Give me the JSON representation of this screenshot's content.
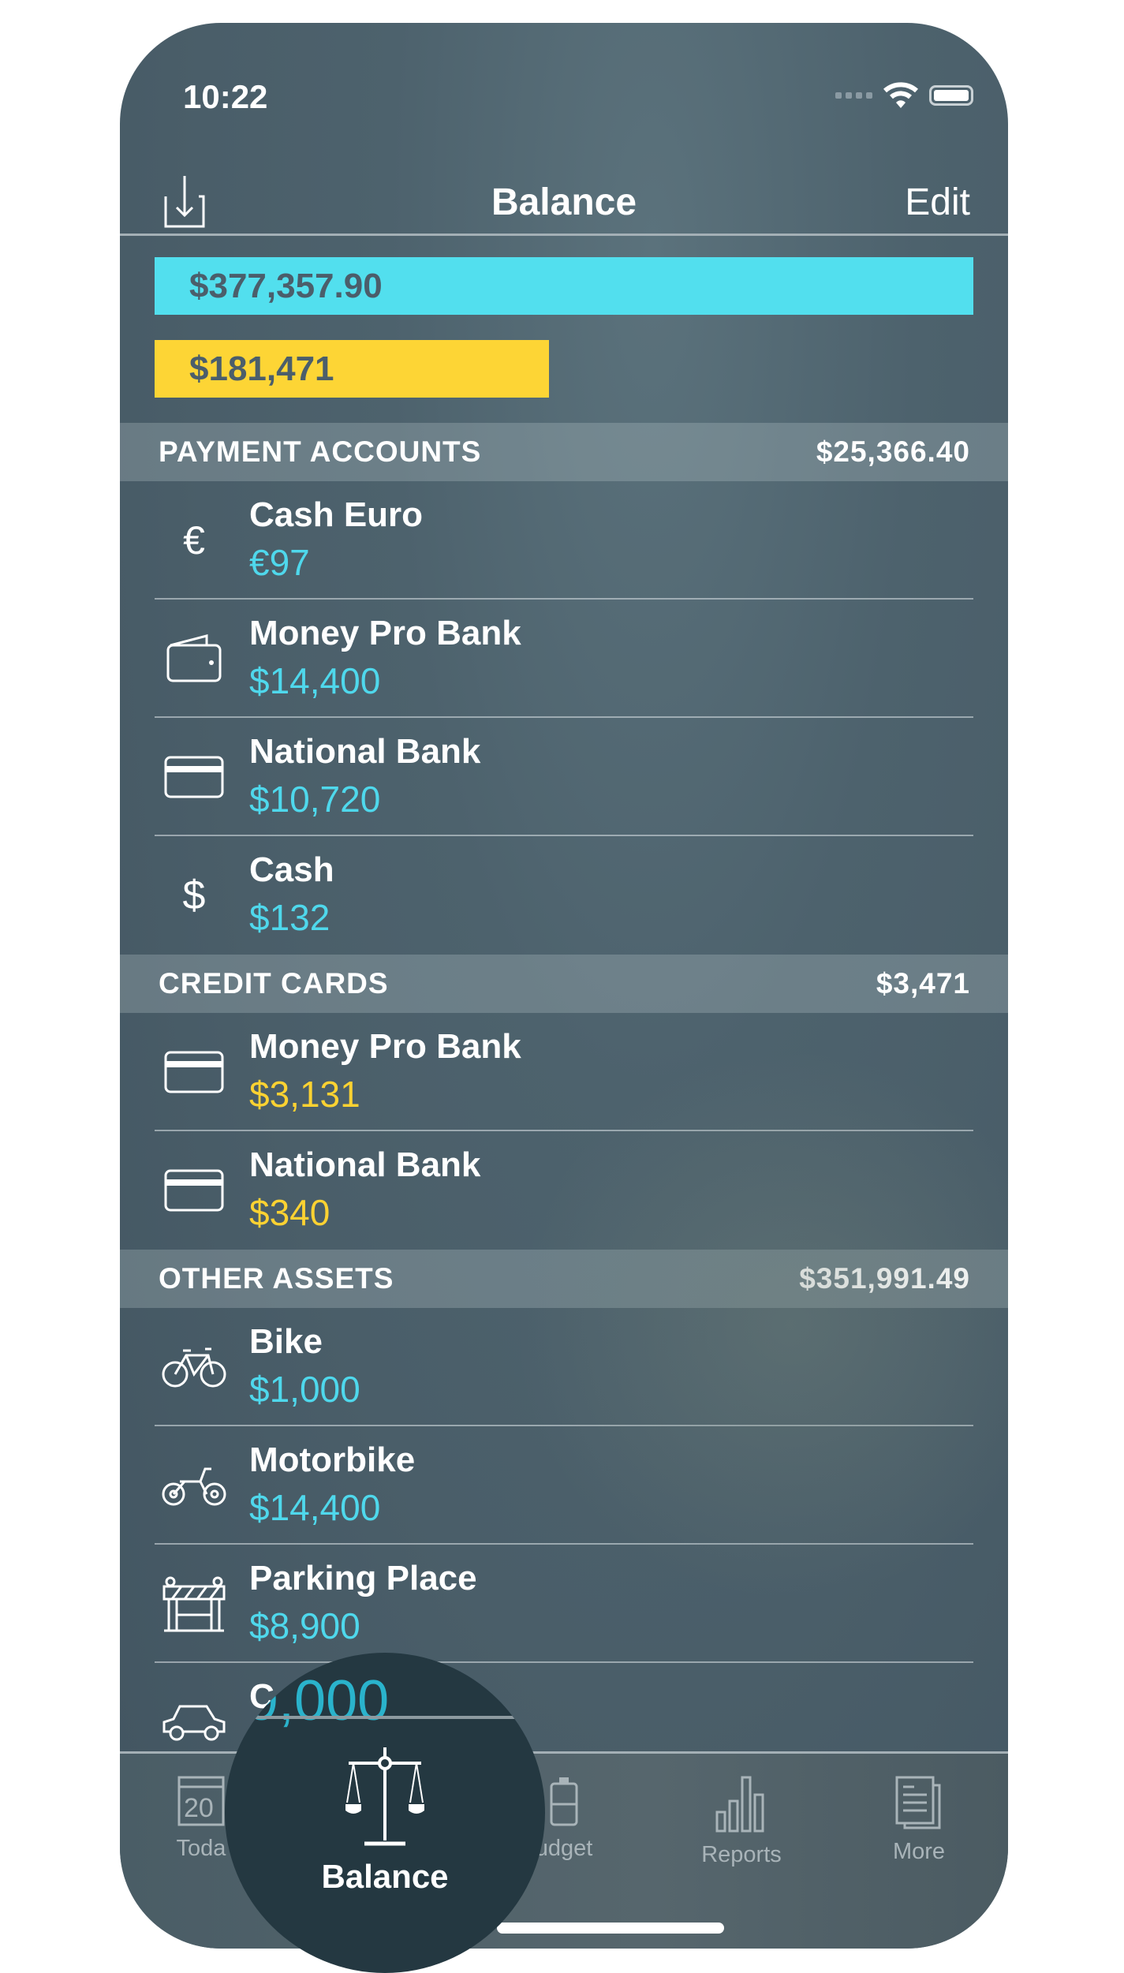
{
  "status_bar": {
    "time": "10:22",
    "wifi_icon": "wifi-icon",
    "battery_icon": "battery-icon"
  },
  "nav": {
    "title": "Balance",
    "edit_label": "Edit",
    "import_icon": "import-icon"
  },
  "summary": {
    "assets_total": "$377,357.90",
    "debts_total": "$181,471",
    "colors": {
      "assets": "#52dfee",
      "debts": "#fdd535"
    },
    "debts_to_assets_fraction": 0.48
  },
  "sections": [
    {
      "title": "PAYMENT ACCOUNTS",
      "total": "$25,366.40",
      "rows": [
        {
          "name": "Cash Euro",
          "amount": "€97",
          "icon": "euro-icon",
          "color": "cyan"
        },
        {
          "name": "Money Pro Bank",
          "amount": "$14,400",
          "icon": "wallet-icon",
          "color": "cyan"
        },
        {
          "name": "National Bank",
          "amount": "$10,720",
          "icon": "card-icon",
          "color": "cyan"
        },
        {
          "name": "Cash",
          "amount": "$132",
          "icon": "dollar-icon",
          "color": "cyan"
        }
      ]
    },
    {
      "title": "CREDIT CARDS",
      "total": "$3,471",
      "rows": [
        {
          "name": "Money Pro Bank",
          "amount": "$3,131",
          "icon": "card-icon",
          "color": "yellow"
        },
        {
          "name": "National Bank",
          "amount": "$340",
          "icon": "card-icon",
          "color": "yellow"
        }
      ]
    },
    {
      "title": "OTHER ASSETS",
      "total": "$351,991.49",
      "rows": [
        {
          "name": "Bike",
          "amount": "$1,000",
          "icon": "bike-icon",
          "color": "cyan"
        },
        {
          "name": "Motorbike",
          "amount": "$14,400",
          "icon": "motorbike-icon",
          "color": "cyan"
        },
        {
          "name": "Parking Place",
          "amount": "$8,900",
          "icon": "parking-icon",
          "color": "cyan"
        },
        {
          "name": "C",
          "amount": "",
          "icon": "car-icon",
          "color": "cyan"
        }
      ]
    }
  ],
  "magnifier": {
    "amount": "9,000",
    "label": "Balance"
  },
  "tabs": [
    {
      "label": "Toda",
      "icon": "calendar-icon",
      "icon_text": "20"
    },
    {
      "label": "Balance",
      "icon": "scales-icon",
      "active": true
    },
    {
      "label": "udget",
      "icon": "budget-icon"
    },
    {
      "label": "Reports",
      "icon": "bar-chart-icon"
    },
    {
      "label": "More",
      "icon": "documents-icon"
    }
  ]
}
